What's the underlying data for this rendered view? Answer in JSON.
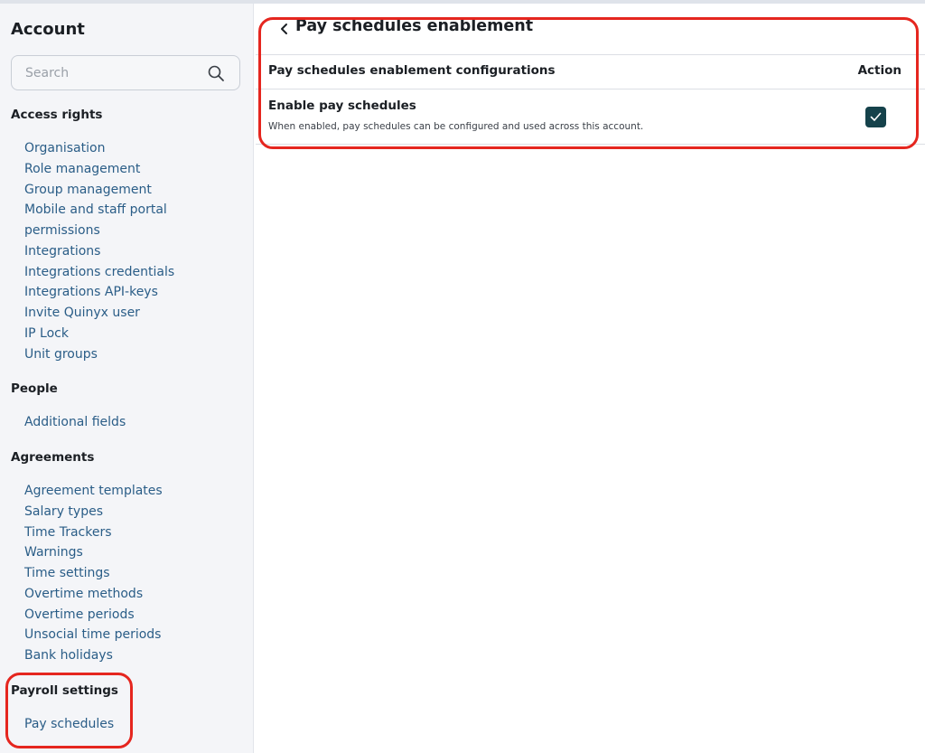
{
  "sidebar": {
    "title": "Account",
    "search": {
      "placeholder": "Search",
      "value": ""
    },
    "sections": [
      {
        "heading": "Access rights",
        "items": [
          "Organisation",
          "Role management",
          "Group management",
          "Mobile and staff portal",
          "permissions",
          "Integrations",
          "Integrations credentials",
          "Integrations API-keys",
          "Invite Quinyx user",
          "IP Lock",
          "Unit groups"
        ]
      },
      {
        "heading": "People",
        "items": [
          "Additional fields"
        ]
      },
      {
        "heading": "Agreements",
        "items": [
          "Agreement templates",
          "Salary types",
          "Time Trackers",
          "Warnings",
          "Time settings",
          "Overtime methods",
          "Overtime periods",
          "Unsocial time periods",
          "Bank holidays"
        ]
      },
      {
        "heading": "Payroll settings",
        "items": [
          "Pay schedules"
        ]
      }
    ]
  },
  "main": {
    "back_icon": "chevron-left-icon",
    "title": "Pay schedules enablement",
    "table": {
      "columns": [
        "Pay schedules enablement configurations",
        "Action"
      ],
      "rows": [
        {
          "title": "Enable pay schedules",
          "description": "When enabled, pay schedules can be configured and used across this account.",
          "checked": true
        }
      ]
    }
  },
  "colors": {
    "link": "#2a5d87",
    "checkbox": "#15424b",
    "highlight": "#e5261f",
    "sidebar_bg": "#f4f5f8"
  }
}
